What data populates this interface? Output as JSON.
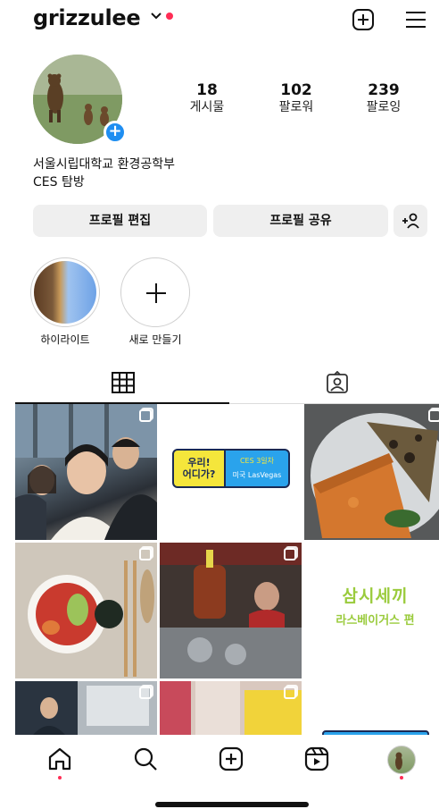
{
  "header": {
    "username": "grizzulee",
    "icons": [
      "chevron-down-icon",
      "notification-dot",
      "create-post-icon",
      "menu-icon"
    ]
  },
  "profile": {
    "stats": [
      {
        "value": "18",
        "label": "게시물"
      },
      {
        "value": "102",
        "label": "팔로워"
      },
      {
        "value": "239",
        "label": "팔로잉"
      }
    ],
    "bio_line1": "서울시립대학교 환경공학부",
    "bio_line2": "CES 탐방"
  },
  "buttons": {
    "edit_profile": "프로필 편집",
    "share_profile": "프로필 공유",
    "add_person": "+ዳ"
  },
  "highlights": [
    {
      "label": "하이라이트"
    },
    {
      "label": "새로 만들기"
    }
  ],
  "tabs": [
    {
      "icon": "grid-icon",
      "active": true
    },
    {
      "icon": "tagged-icon",
      "active": false
    }
  ],
  "posts": {
    "banner_left": "우리!\n어디가?",
    "banner_right_top": "CES 3일차",
    "banner_right_bottom": "미국 LasVegas",
    "show_title": "삼시세끼",
    "show_subtitle": "라스베이거스 편"
  },
  "bottom_nav": [
    "home-icon",
    "search-icon",
    "create-icon",
    "reels-icon",
    "profile-avatar"
  ],
  "colors": {
    "accent_blue": "#1f8ef1",
    "notification_red": "#ff2d55",
    "button_grey": "#efefef"
  }
}
